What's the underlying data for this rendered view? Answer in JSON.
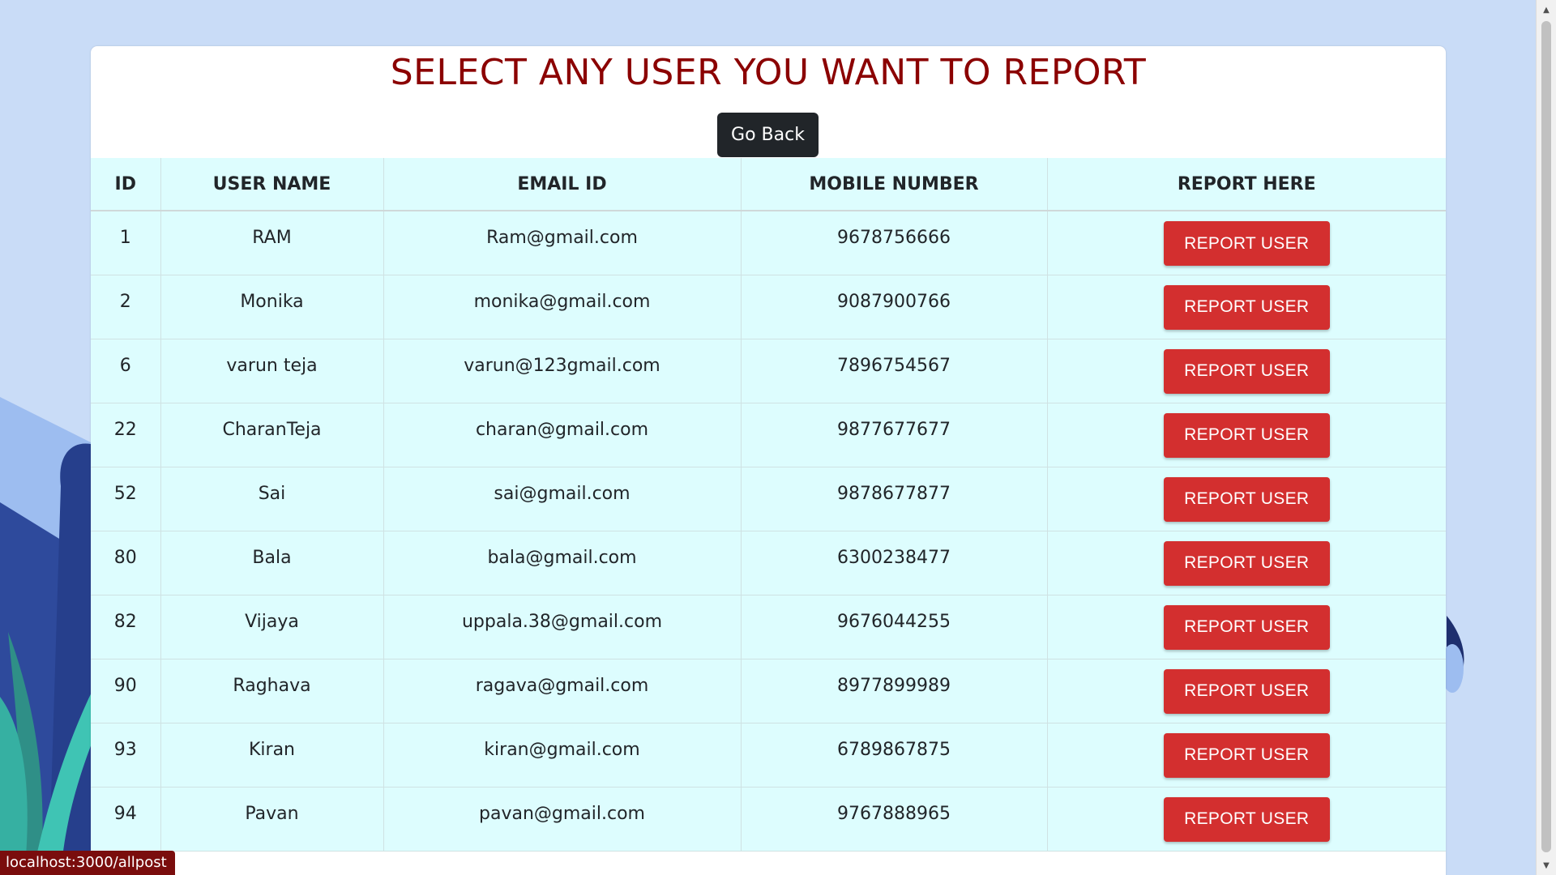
{
  "page": {
    "title": "SELECT ANY USER YOU WANT TO REPORT",
    "go_back_label": "Go Back"
  },
  "table": {
    "headers": [
      "ID",
      "USER NAME",
      "EMAIL ID",
      "MOBILE NUMBER",
      "REPORT HERE"
    ],
    "rows": [
      {
        "id": "1",
        "name": "RAM",
        "email": "Ram@gmail.com",
        "mobile": "9678756666",
        "action": "REPORT USER"
      },
      {
        "id": "2",
        "name": "Monika",
        "email": "monika@gmail.com",
        "mobile": "9087900766",
        "action": "REPORT USER"
      },
      {
        "id": "6",
        "name": "varun teja",
        "email": "varun@123gmail.com",
        "mobile": "7896754567",
        "action": "REPORT USER"
      },
      {
        "id": "22",
        "name": "CharanTeja",
        "email": "charan@gmail.com",
        "mobile": "9877677677",
        "action": "REPORT USER"
      },
      {
        "id": "52",
        "name": "Sai",
        "email": "sai@gmail.com",
        "mobile": "9878677877",
        "action": "REPORT USER"
      },
      {
        "id": "80",
        "name": "Bala",
        "email": "bala@gmail.com",
        "mobile": "6300238477",
        "action": "REPORT USER"
      },
      {
        "id": "82",
        "name": "Vijaya",
        "email": "uppala.38@gmail.com",
        "mobile": "9676044255",
        "action": "REPORT USER"
      },
      {
        "id": "90",
        "name": "Raghava",
        "email": "ragava@gmail.com",
        "mobile": "8977899989",
        "action": "REPORT USER"
      },
      {
        "id": "93",
        "name": "Kiran",
        "email": "kiran@gmail.com",
        "mobile": "6789867875",
        "action": "REPORT USER"
      },
      {
        "id": "94",
        "name": "Pavan",
        "email": "pavan@gmail.com",
        "mobile": "9767888965",
        "action": "REPORT USER"
      }
    ]
  },
  "status_bar": {
    "url": "localhost:3000/allpost"
  },
  "colors": {
    "title": "#8b0000",
    "report_button": "#d32f2f",
    "go_back_button": "#212529",
    "table_bg": "#ddfdfe",
    "page_bg": "#c9dcf7"
  }
}
